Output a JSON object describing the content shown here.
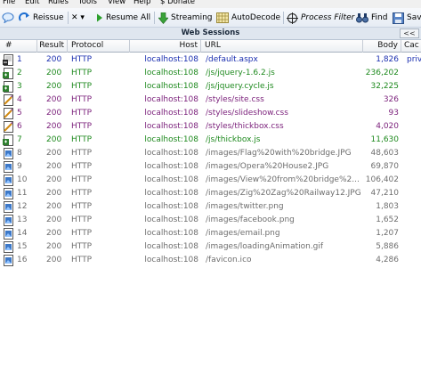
{
  "menu": [
    "File",
    "Edit",
    "Rules",
    "Tools",
    "View",
    "Help",
    "$ Donate"
  ],
  "toolbar": {
    "reissue": "Reissue",
    "remove": "✕ ▾",
    "resume_all": "Resume All",
    "streaming": "Streaming",
    "autodecode": "AutoDecode",
    "process_filter": "Process Filter",
    "find": "Find",
    "save": "Sav"
  },
  "panel": {
    "title": "Web Sessions",
    "collapse": "<<"
  },
  "columns": [
    "#",
    "Result",
    "Protocol",
    "Host",
    "URL",
    "Body",
    "Cac"
  ],
  "colors": {
    "html": "#1b2fb0",
    "script": "#1f8a1f",
    "css": "#7a1f7a",
    "image": "#6e6e6e"
  },
  "sessions": [
    {
      "num": "1",
      "result": "200",
      "protocol": "HTTP",
      "host": "localhost:108",
      "url": "/default.aspx",
      "body": "1,826",
      "cache": "priv",
      "type": "html"
    },
    {
      "num": "2",
      "result": "200",
      "protocol": "HTTP",
      "host": "localhost:108",
      "url": "/js/jquery-1.6.2.js",
      "body": "236,202",
      "cache": "",
      "type": "script"
    },
    {
      "num": "3",
      "result": "200",
      "protocol": "HTTP",
      "host": "localhost:108",
      "url": "/js/jquery.cycle.js",
      "body": "32,225",
      "cache": "",
      "type": "script"
    },
    {
      "num": "4",
      "result": "200",
      "protocol": "HTTP",
      "host": "localhost:108",
      "url": "/styles/site.css",
      "body": "326",
      "cache": "",
      "type": "css"
    },
    {
      "num": "5",
      "result": "200",
      "protocol": "HTTP",
      "host": "localhost:108",
      "url": "/styles/slideshow.css",
      "body": "93",
      "cache": "",
      "type": "css"
    },
    {
      "num": "6",
      "result": "200",
      "protocol": "HTTP",
      "host": "localhost:108",
      "url": "/styles/thickbox.css",
      "body": "4,020",
      "cache": "",
      "type": "css"
    },
    {
      "num": "7",
      "result": "200",
      "protocol": "HTTP",
      "host": "localhost:108",
      "url": "/js/thickbox.js",
      "body": "11,630",
      "cache": "",
      "type": "script"
    },
    {
      "num": "8",
      "result": "200",
      "protocol": "HTTP",
      "host": "localhost:108",
      "url": "/images/Flag%20with%20bridge.JPG",
      "body": "48,603",
      "cache": "",
      "type": "image"
    },
    {
      "num": "9",
      "result": "200",
      "protocol": "HTTP",
      "host": "localhost:108",
      "url": "/images/Opera%20House2.JPG",
      "body": "69,870",
      "cache": "",
      "type": "image"
    },
    {
      "num": "10",
      "result": "200",
      "protocol": "HTTP",
      "host": "localhost:108",
      "url": "/images/View%20from%20bridge%2...",
      "body": "106,402",
      "cache": "",
      "type": "image"
    },
    {
      "num": "11",
      "result": "200",
      "protocol": "HTTP",
      "host": "localhost:108",
      "url": "/images/Zig%20Zag%20Railway12.JPG",
      "body": "47,210",
      "cache": "",
      "type": "image"
    },
    {
      "num": "12",
      "result": "200",
      "protocol": "HTTP",
      "host": "localhost:108",
      "url": "/images/twitter.png",
      "body": "1,803",
      "cache": "",
      "type": "image"
    },
    {
      "num": "13",
      "result": "200",
      "protocol": "HTTP",
      "host": "localhost:108",
      "url": "/images/facebook.png",
      "body": "1,652",
      "cache": "",
      "type": "image"
    },
    {
      "num": "14",
      "result": "200",
      "protocol": "HTTP",
      "host": "localhost:108",
      "url": "/images/email.png",
      "body": "1,207",
      "cache": "",
      "type": "image"
    },
    {
      "num": "15",
      "result": "200",
      "protocol": "HTTP",
      "host": "localhost:108",
      "url": "/images/loadingAnimation.gif",
      "body": "5,886",
      "cache": "",
      "type": "image"
    },
    {
      "num": "16",
      "result": "200",
      "protocol": "HTTP",
      "host": "localhost:108",
      "url": "/favicon.ico",
      "body": "4,286",
      "cache": "",
      "type": "image"
    }
  ]
}
